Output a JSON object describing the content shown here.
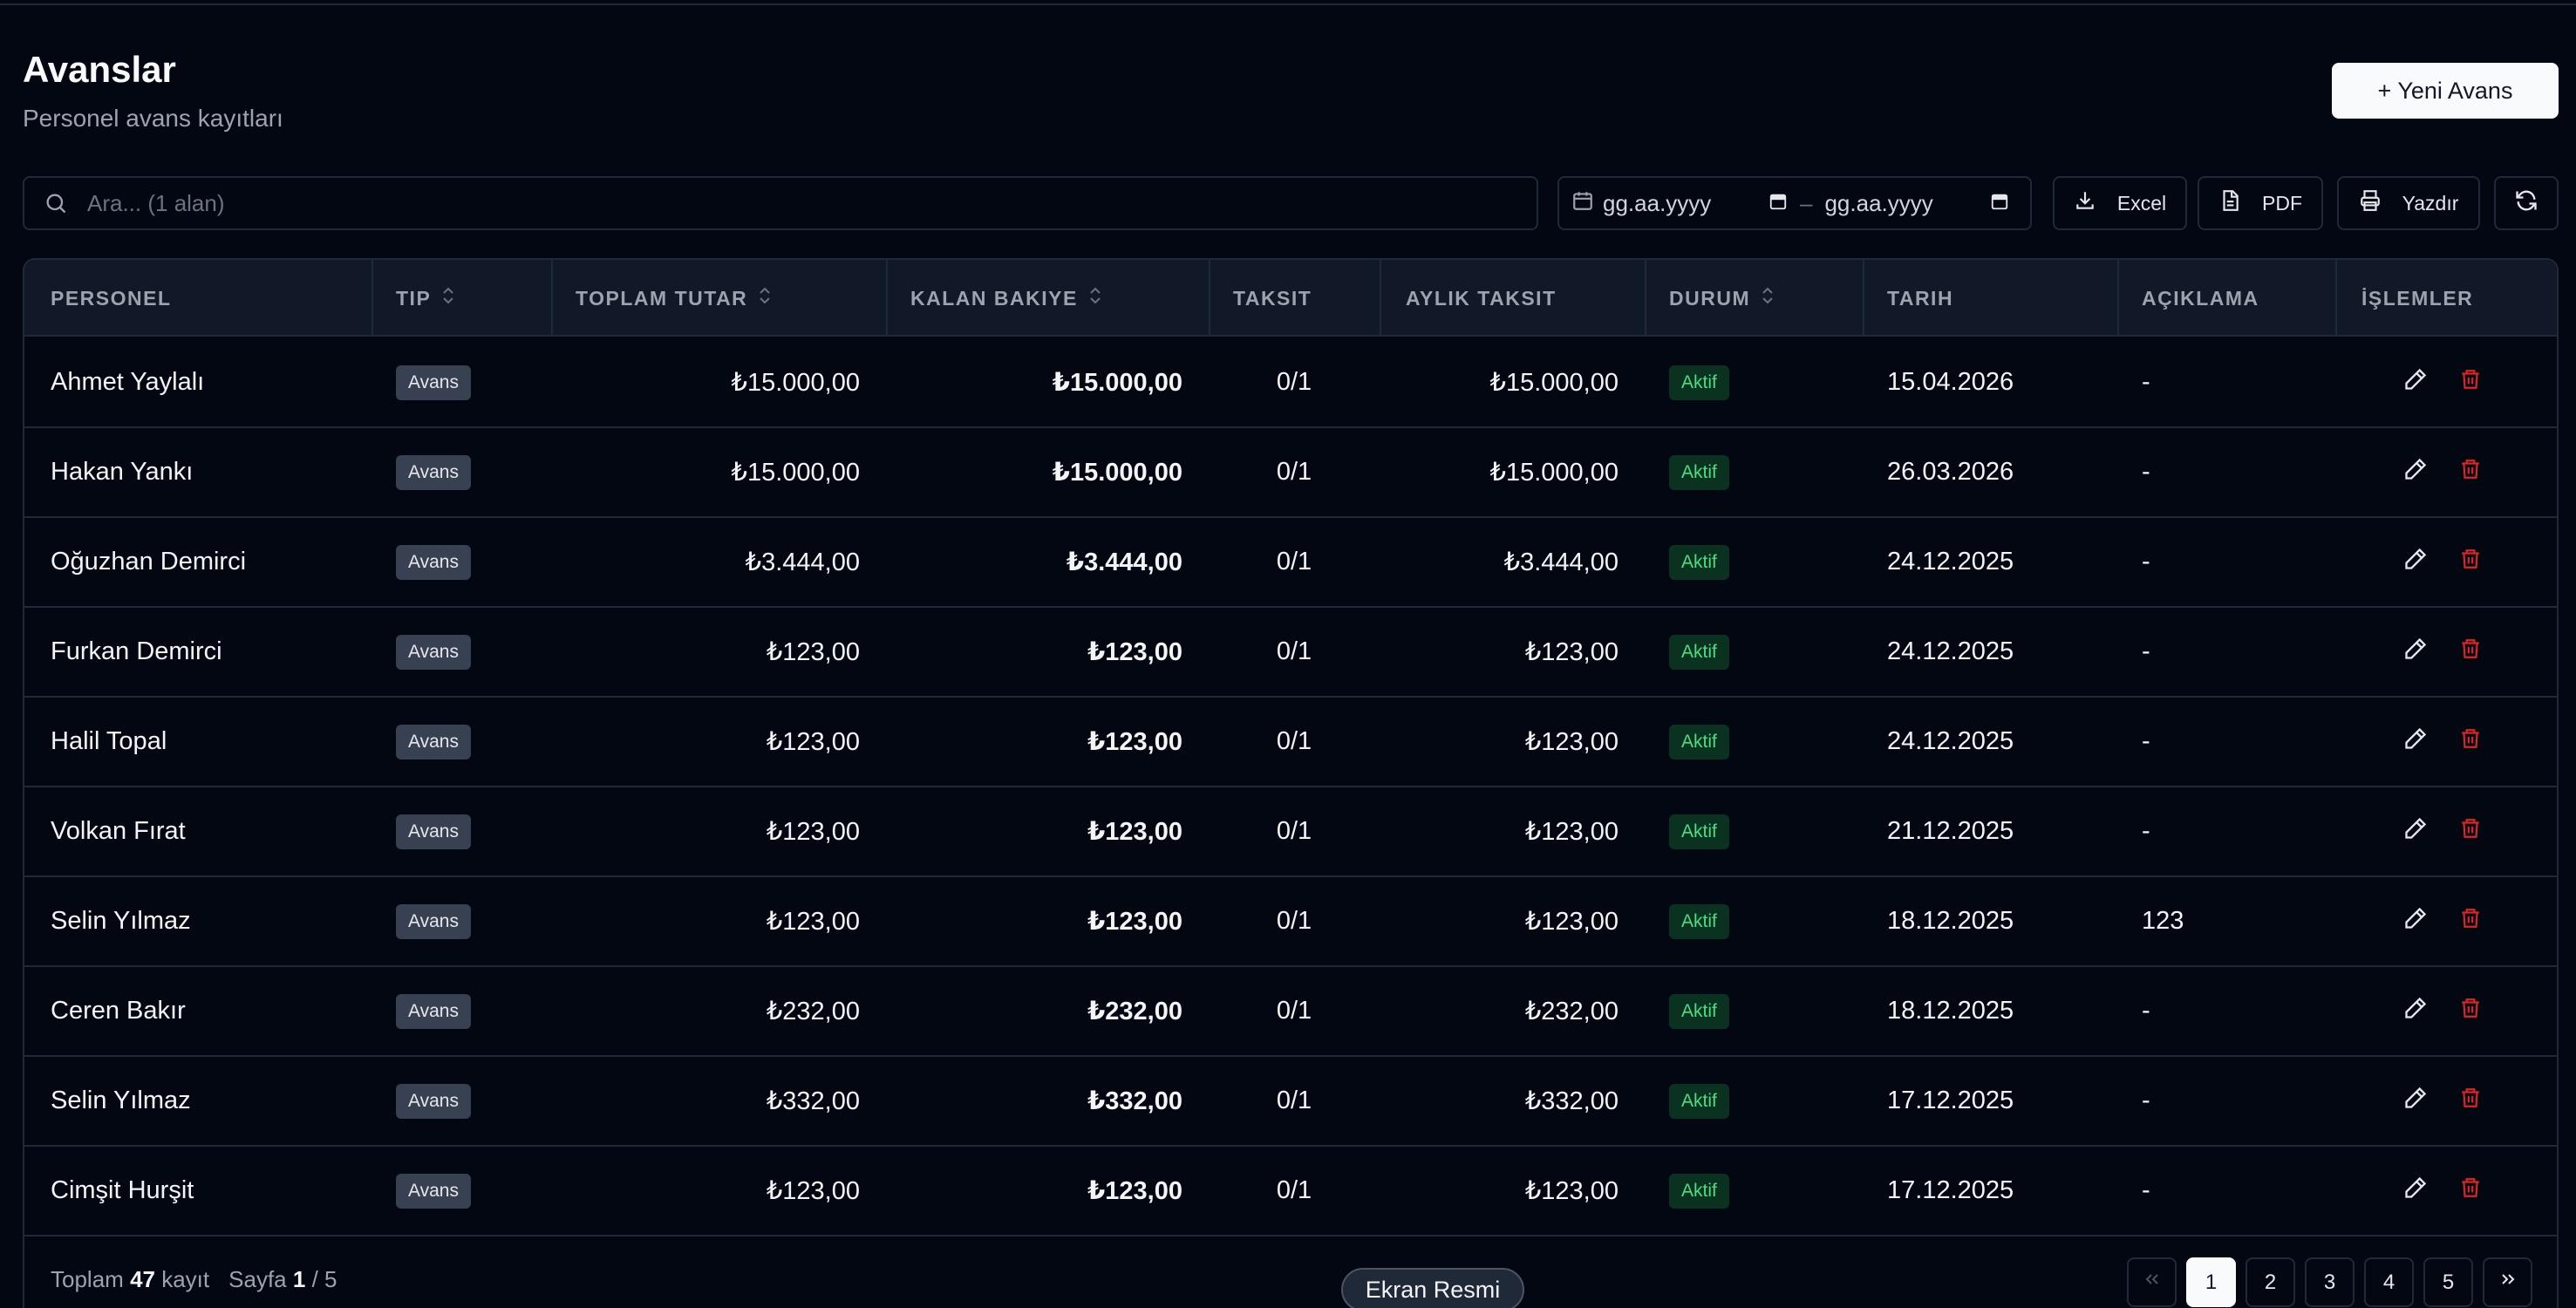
{
  "header": {
    "title": "Avanslar",
    "subtitle": "Personel avans kayıtları",
    "new_button_label": "+ Yeni Avans"
  },
  "toolbar": {
    "search_placeholder": "Ara... (1 alan)",
    "date_from_placeholder": "gg.aa.yyyy",
    "date_separator": "–",
    "date_to_placeholder": "gg.aa.yyyy",
    "excel_label": "Excel",
    "pdf_label": "PDF",
    "print_label": "Yazdır"
  },
  "table": {
    "columns": [
      "PERSONEL",
      "TIP",
      "TOPLAM TUTAR",
      "KALAN BAKIYE",
      "TAKSIT",
      "AYLIK TAKSIT",
      "DURUM",
      "TARIH",
      "AÇIKLAMA",
      "İŞLEMLER"
    ],
    "rows": [
      {
        "personel": "Ahmet Yaylalı",
        "tip": "Avans",
        "toplam": "₺15.000,00",
        "kalan": "₺15.000,00",
        "taksit": "0/1",
        "aylik": "₺15.000,00",
        "durum": "Aktif",
        "tarih": "15.04.2026",
        "aciklama": "-"
      },
      {
        "personel": "Hakan Yankı",
        "tip": "Avans",
        "toplam": "₺15.000,00",
        "kalan": "₺15.000,00",
        "taksit": "0/1",
        "aylik": "₺15.000,00",
        "durum": "Aktif",
        "tarih": "26.03.2026",
        "aciklama": "-"
      },
      {
        "personel": "Oğuzhan Demirci",
        "tip": "Avans",
        "toplam": "₺3.444,00",
        "kalan": "₺3.444,00",
        "taksit": "0/1",
        "aylik": "₺3.444,00",
        "durum": "Aktif",
        "tarih": "24.12.2025",
        "aciklama": "-"
      },
      {
        "personel": "Furkan Demirci",
        "tip": "Avans",
        "toplam": "₺123,00",
        "kalan": "₺123,00",
        "taksit": "0/1",
        "aylik": "₺123,00",
        "durum": "Aktif",
        "tarih": "24.12.2025",
        "aciklama": "-"
      },
      {
        "personel": "Halil Topal",
        "tip": "Avans",
        "toplam": "₺123,00",
        "kalan": "₺123,00",
        "taksit": "0/1",
        "aylik": "₺123,00",
        "durum": "Aktif",
        "tarih": "24.12.2025",
        "aciklama": "-"
      },
      {
        "personel": "Volkan Fırat",
        "tip": "Avans",
        "toplam": "₺123,00",
        "kalan": "₺123,00",
        "taksit": "0/1",
        "aylik": "₺123,00",
        "durum": "Aktif",
        "tarih": "21.12.2025",
        "aciklama": "-"
      },
      {
        "personel": "Selin Yılmaz",
        "tip": "Avans",
        "toplam": "₺123,00",
        "kalan": "₺123,00",
        "taksit": "0/1",
        "aylik": "₺123,00",
        "durum": "Aktif",
        "tarih": "18.12.2025",
        "aciklama": "123"
      },
      {
        "personel": "Ceren Bakır",
        "tip": "Avans",
        "toplam": "₺232,00",
        "kalan": "₺232,00",
        "taksit": "0/1",
        "aylik": "₺232,00",
        "durum": "Aktif",
        "tarih": "18.12.2025",
        "aciklama": "-"
      },
      {
        "personel": "Selin Yılmaz",
        "tip": "Avans",
        "toplam": "₺332,00",
        "kalan": "₺332,00",
        "taksit": "0/1",
        "aylik": "₺332,00",
        "durum": "Aktif",
        "tarih": "17.12.2025",
        "aciklama": "-"
      },
      {
        "personel": "Cimşit Hurşit",
        "tip": "Avans",
        "toplam": "₺123,00",
        "kalan": "₺123,00",
        "taksit": "0/1",
        "aylik": "₺123,00",
        "durum": "Aktif",
        "tarih": "17.12.2025",
        "aciklama": "-"
      }
    ]
  },
  "footer": {
    "total_prefix": "Toplam",
    "total_count": "47",
    "total_suffix": "kayıt",
    "page_prefix": "Sayfa",
    "page_current": "1",
    "page_total": "/ 5",
    "pages": [
      "1",
      "2",
      "3",
      "4",
      "5"
    ]
  },
  "screenshot_button_label": "Ekran Resmi",
  "colors": {
    "background": "#030712",
    "header_bg": "#111827",
    "border": "#1f2937",
    "status_active_text": "#4ade80",
    "delete_icon": "#dc2626"
  },
  "icons": [
    "search-icon",
    "calendar-icon",
    "download-icon",
    "file-text-icon",
    "printer-icon",
    "refresh-icon",
    "sort-icon",
    "pencil-icon",
    "trash-icon",
    "chevrons-left-icon",
    "chevrons-right-icon"
  ]
}
